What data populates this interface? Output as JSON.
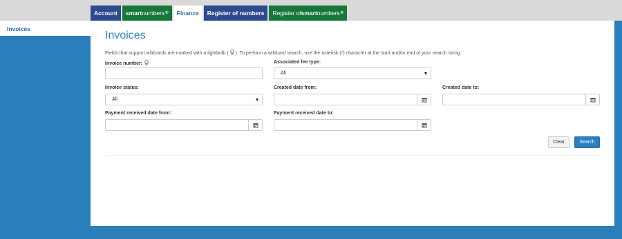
{
  "tabs": [
    {
      "label": "Account"
    },
    {
      "label_bold": "smart",
      "label_light": "numbers",
      "reg": "®"
    },
    {
      "label": "Finance"
    },
    {
      "label": "Register of numbers"
    },
    {
      "label_prefix": "Register of ",
      "label_bold": "smart",
      "label_light": "numbers",
      "reg": "®"
    }
  ],
  "sidebar": {
    "items": [
      {
        "label": "Invoices"
      }
    ]
  },
  "main": {
    "title": "Invoices",
    "hint_before": "Fields that support wildcards are marked with a lightbulb (",
    "hint_after": "). To perform a wildcard search, use the asterisk (*) character at the start and/or end of your search string."
  },
  "form": {
    "invoice_number": {
      "label": "Invoice number:",
      "value": ""
    },
    "associated_fee_type": {
      "label": "Associated fee type:",
      "value": "All"
    },
    "invoice_status": {
      "label": "Invoice status:",
      "value": "All"
    },
    "created_date_from": {
      "label": "Created date from:",
      "value": ""
    },
    "created_date_to": {
      "label": "Created date to:",
      "value": ""
    },
    "payment_received_from": {
      "label": "Payment received date from:",
      "value": ""
    },
    "payment_received_to": {
      "label": "Payment received date to:",
      "value": ""
    }
  },
  "buttons": {
    "clear": "Clear",
    "search": "Search"
  },
  "icons": {
    "bulb": "lightbulb-icon",
    "calendar": "calendar-icon",
    "caret": "caret-down-icon"
  },
  "colors": {
    "brand_blue": "#2e4a8f",
    "brand_green": "#17773b",
    "background": "#2a7fba",
    "accent": "#2a86c4"
  }
}
